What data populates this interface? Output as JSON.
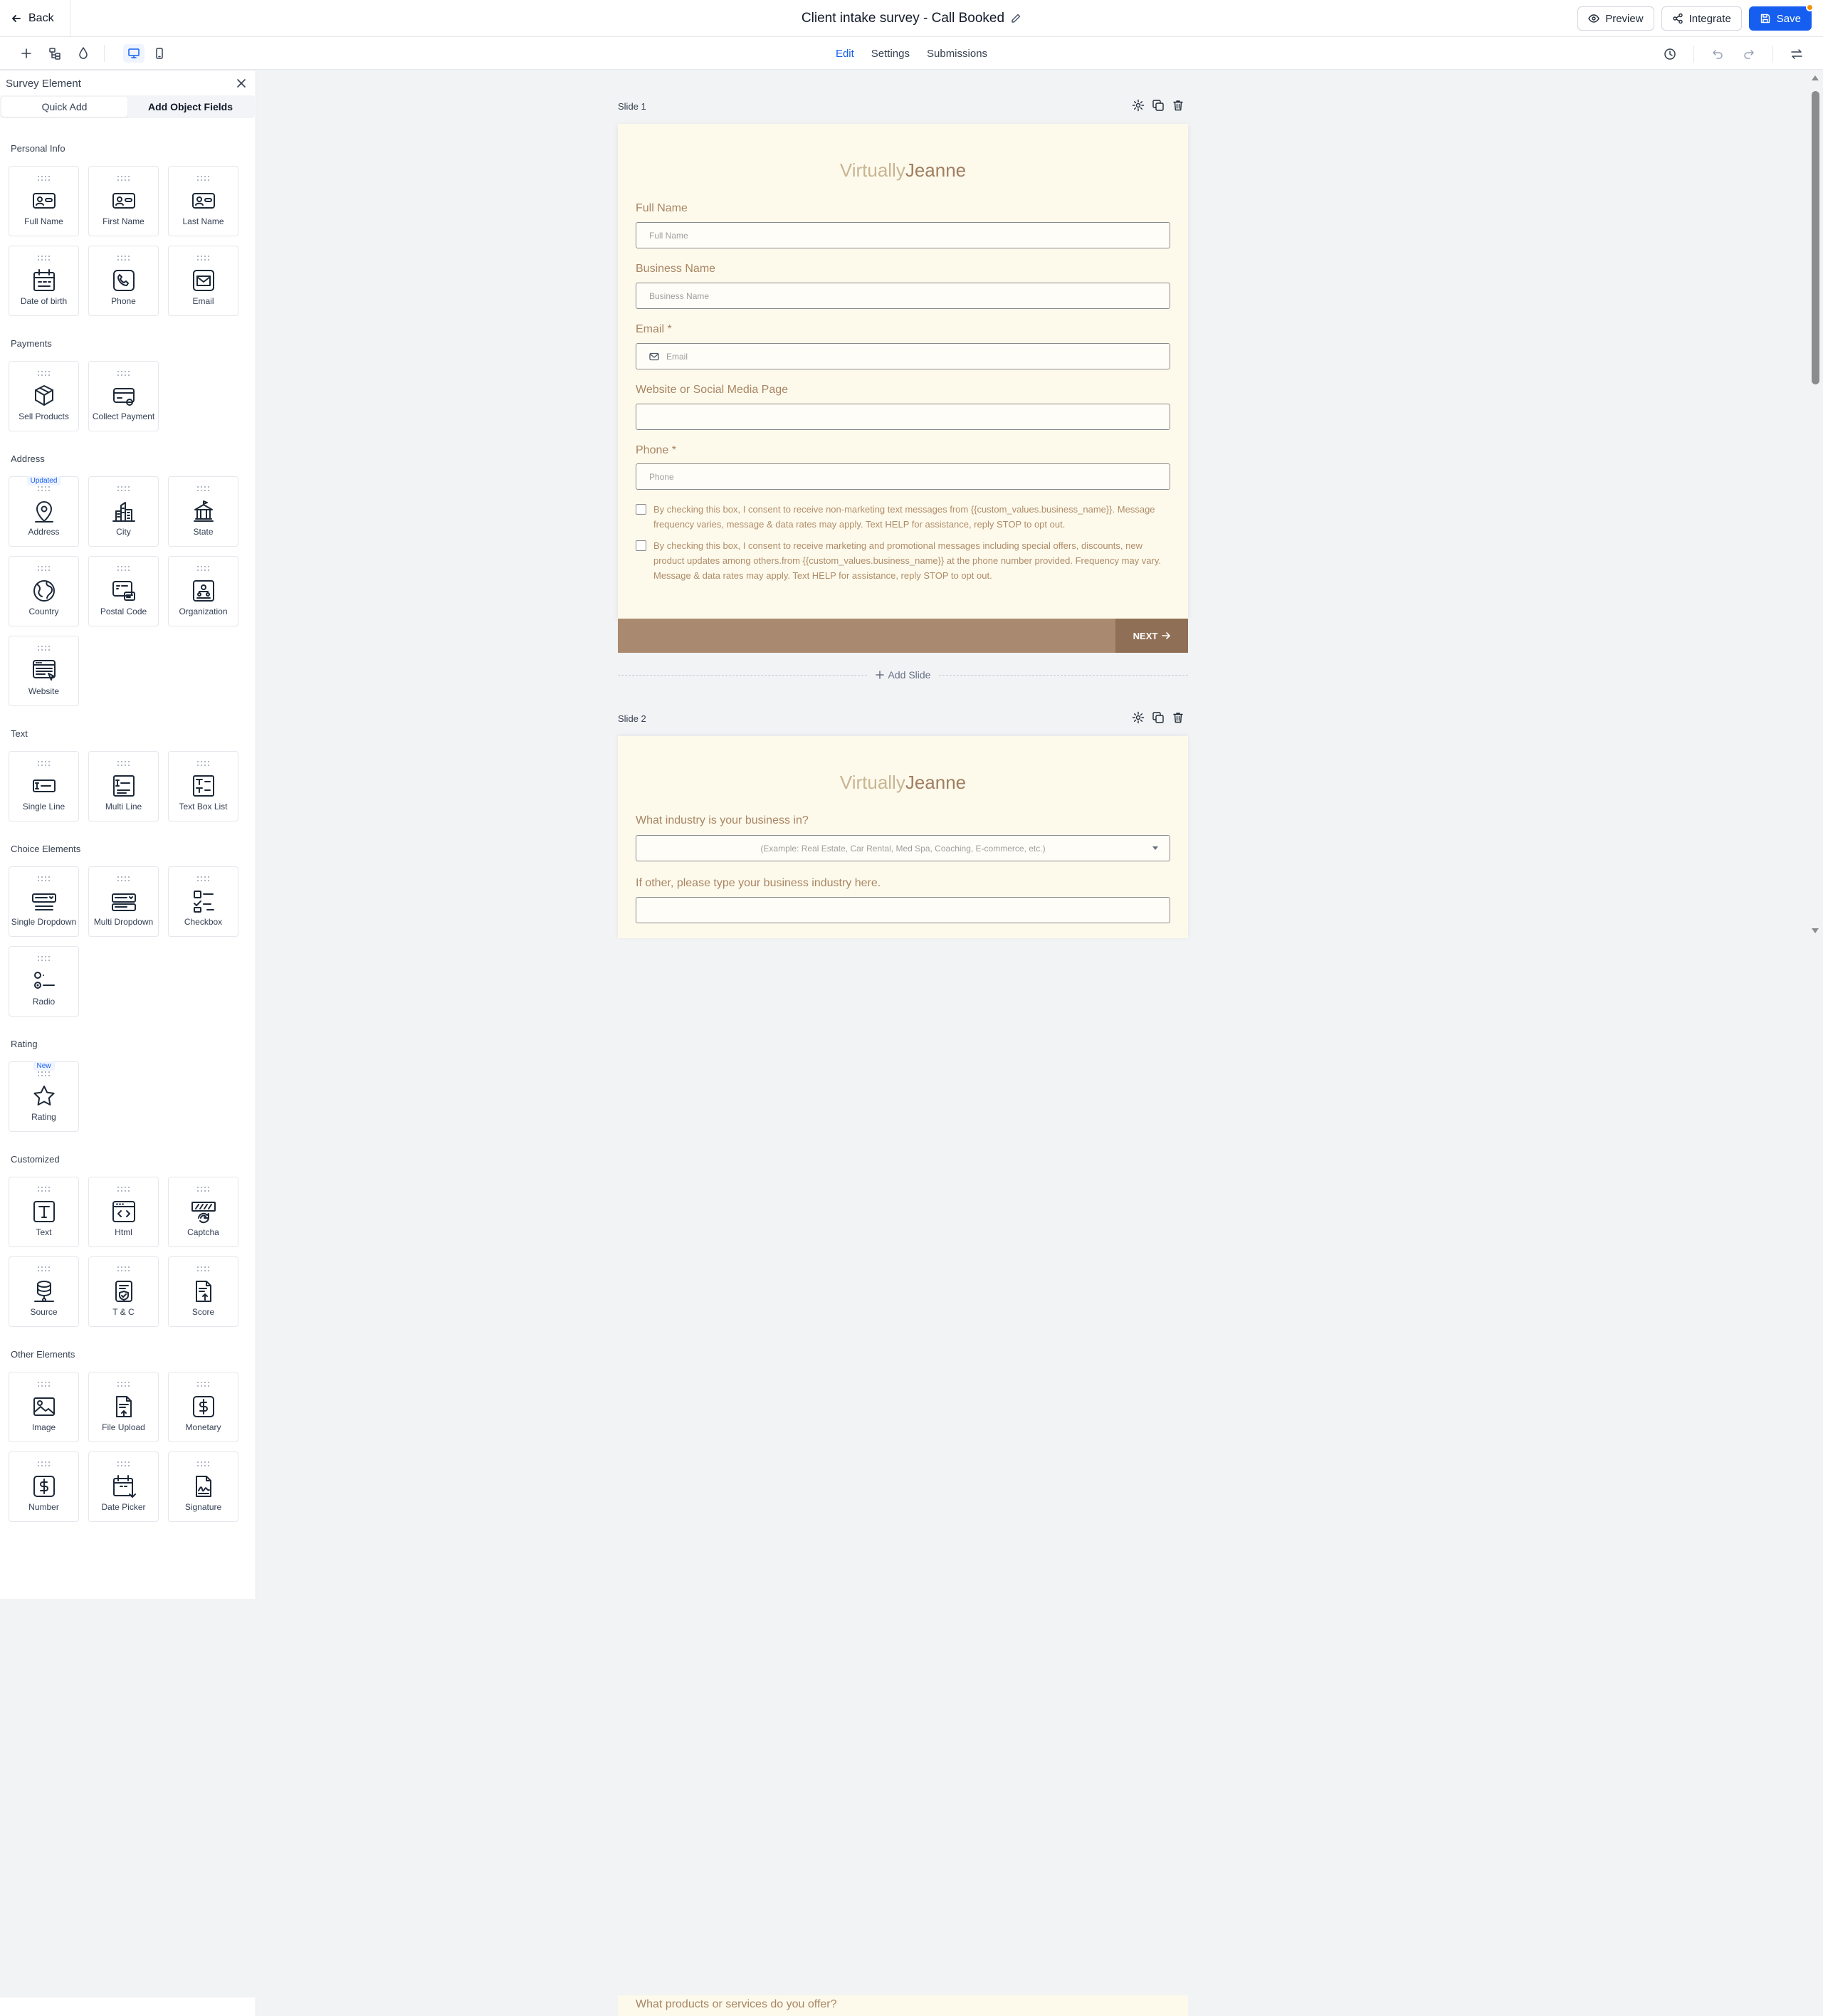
{
  "header": {
    "back_label": "Back",
    "title": "Client intake survey - Call Booked",
    "preview_label": "Preview",
    "integrate_label": "Integrate",
    "save_label": "Save"
  },
  "subbar": {
    "tabs": [
      "Edit",
      "Settings",
      "Submissions"
    ],
    "active_tab": "Edit"
  },
  "sidebar": {
    "title": "Survey Element",
    "tabs": [
      "Quick Add",
      "Add Object Fields"
    ],
    "sections": [
      {
        "title": "Personal Info",
        "items": [
          {
            "label": "Full Name",
            "icon": "id-card-icon"
          },
          {
            "label": "First Name",
            "icon": "id-card-icon"
          },
          {
            "label": "Last Name",
            "icon": "id-card-icon"
          },
          {
            "label": "Date of birth",
            "icon": "calendar-icon"
          },
          {
            "label": "Phone",
            "icon": "phone-icon"
          },
          {
            "label": "Email",
            "icon": "mail-icon"
          }
        ]
      },
      {
        "title": "Payments",
        "items": [
          {
            "label": "Sell Products",
            "icon": "box-icon"
          },
          {
            "label": "Collect Payment",
            "icon": "credit-card-icon"
          }
        ]
      },
      {
        "title": "Address",
        "items": [
          {
            "label": "Address",
            "icon": "map-pin-icon",
            "badge": "Updated"
          },
          {
            "label": "City",
            "icon": "city-icon"
          },
          {
            "label": "State",
            "icon": "state-building-icon"
          },
          {
            "label": "Country",
            "icon": "globe-icon"
          },
          {
            "label": "Postal Code",
            "icon": "postal-code-icon"
          },
          {
            "label": "Organization",
            "icon": "organization-icon"
          },
          {
            "label": "Website",
            "icon": "website-icon"
          }
        ]
      },
      {
        "title": "Text",
        "items": [
          {
            "label": "Single Line",
            "icon": "single-line-icon"
          },
          {
            "label": "Multi Line",
            "icon": "multi-line-icon"
          },
          {
            "label": "Text Box List",
            "icon": "text-box-list-icon"
          }
        ]
      },
      {
        "title": "Choice Elements",
        "items": [
          {
            "label": "Single Dropdown",
            "icon": "dropdown-icon"
          },
          {
            "label": "Multi Dropdown",
            "icon": "multi-dropdown-icon"
          },
          {
            "label": "Checkbox",
            "icon": "checkbox-icon"
          },
          {
            "label": "Radio",
            "icon": "radio-icon"
          }
        ]
      },
      {
        "title": "Rating",
        "items": [
          {
            "label": "Rating",
            "icon": "star-icon",
            "badge": "New"
          }
        ]
      },
      {
        "title": "Customized",
        "items": [
          {
            "label": "Text",
            "icon": "text-icon"
          },
          {
            "label": "Html",
            "icon": "html-icon"
          },
          {
            "label": "Captcha",
            "icon": "captcha-icon"
          },
          {
            "label": "Source",
            "icon": "source-icon"
          },
          {
            "label": "T & C",
            "icon": "terms-icon"
          },
          {
            "label": "Score",
            "icon": "score-icon"
          }
        ]
      },
      {
        "title": "Other Elements",
        "items": [
          {
            "label": "Image",
            "icon": "image-icon"
          },
          {
            "label": "File Upload",
            "icon": "file-upload-icon"
          },
          {
            "label": "Monetary",
            "icon": "dollar-icon"
          },
          {
            "label": "Number",
            "icon": "dollar-icon"
          },
          {
            "label": "Date Picker",
            "icon": "date-picker-icon"
          },
          {
            "label": "Signature",
            "icon": "signature-icon"
          }
        ]
      }
    ]
  },
  "canvas": {
    "add_slide_label": "Add Slide",
    "slide1": {
      "label": "Slide 1",
      "logo_light": "Virtually",
      "logo_dark": "Jeanne",
      "fields": [
        {
          "label": "Full Name",
          "placeholder": "Full Name",
          "required": false
        },
        {
          "label": "Business Name",
          "placeholder": "Business Name",
          "required": false
        },
        {
          "label": "Email",
          "placeholder": "Email",
          "required": true
        },
        {
          "label": "Website or Social Media Page",
          "placeholder": "",
          "required": false
        },
        {
          "label": "Phone",
          "placeholder": "Phone",
          "required": true
        }
      ],
      "consent1": "By checking this box, I consent to receive non-marketing text messages from {{custom_values.business_name}}. Message frequency varies, message & data rates may apply. Text HELP for assistance, reply STOP to opt out.",
      "consent2": "By checking this box, I consent to receive marketing and promotional messages including special offers, discounts, new product updates among others.from {{custom_values.business_name}} at the phone number provided. Frequency may vary. Message & data rates may apply. Text HELP for assistance, reply STOP to opt out.",
      "next_label": "NEXT"
    },
    "slide2": {
      "label": "Slide 2",
      "logo_light": "Virtually",
      "logo_dark": "Jeanne",
      "q1": "What industry is your business in?",
      "q1_placeholder": "(Example: Real Estate, Car Rental, Med Spa, Coaching, E-commerce, etc.)",
      "q2": "If other, please type your business industry here."
    },
    "slide3_partial_label": "What products or services do you offer?"
  },
  "colors": {
    "primary": "#155eef",
    "form_bg": "#fdfaec",
    "form_label": "#a98563",
    "footer": "#a98a70",
    "next_button": "#8f6f55"
  }
}
